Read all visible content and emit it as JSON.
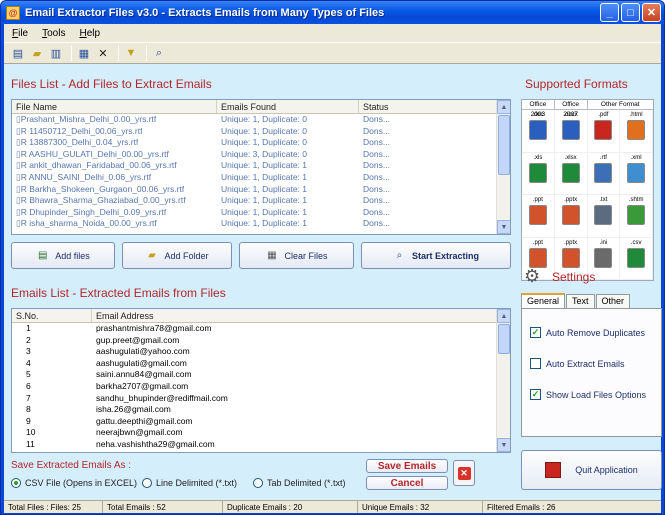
{
  "window": {
    "title": "Email Extractor Files v3.0 - Extracts Emails from Many Types of Files"
  },
  "menu": [
    {
      "key": "F",
      "rest": "ile"
    },
    {
      "key": "T",
      "rest": "ools"
    },
    {
      "key": "H",
      "rest": "elp"
    }
  ],
  "files_section": {
    "title": "Files List - Add Files to Extract Emails",
    "headers": [
      "File Name",
      "Emails Found",
      "Status"
    ],
    "rows": [
      [
        "Prashant_Mishra_Delhi_0.00_yrs.rtf",
        "Unique: 1, Duplicate: 0",
        "Dons..."
      ],
      [
        "R 11450712_Delhi_00.06_yrs.rtf",
        "Unique: 1, Duplicate: 0",
        "Dons..."
      ],
      [
        "R 13887300_Delhi_0.04_yrs.rtf",
        "Unique: 1, Duplicate: 0",
        "Dons..."
      ],
      [
        "R AASHU_GULATI_Delhi_00.00_yrs.rtf",
        "Unique: 3, Duplicate: 0",
        "Dons..."
      ],
      [
        "R ankit_dhawan_Faridabad_00.06_yrs.rtf",
        "Unique: 1, Duplicate: 1",
        "Dons..."
      ],
      [
        "R ANNU_SAINI_Delhi_0.06_yrs.rtf",
        "Unique: 1, Duplicate: 1",
        "Dons..."
      ],
      [
        "R Barkha_Shokeen_Gurgaon_00.06_yrs.rtf",
        "Unique: 1, Duplicate: 1",
        "Dons..."
      ],
      [
        "R Bhawra_Sharma_Ghaziabad_0.00_yrs.rtf",
        "Unique: 1, Duplicate: 1",
        "Dons..."
      ],
      [
        "R Dhupinder_Singh_Delhi_0.09_yrs.rtf",
        "Unique: 1, Duplicate: 1",
        "Dons..."
      ],
      [
        "R isha_sharma_Noida_00.00_yrs.rtf",
        "Unique: 1, Duplicate: 1",
        "Dons..."
      ]
    ]
  },
  "buttons": {
    "add_files": "Add files",
    "add_folder": "Add Folder",
    "clear_files": "Clear Files",
    "start_extracting": "Start Extracting",
    "save_emails": "Save Emails",
    "cancel": "Cancel",
    "quit": "Quit Application"
  },
  "emails_section": {
    "title": "Emails List - Extracted Emails from Files",
    "headers": [
      "S.No.",
      "Email Address"
    ],
    "rows": [
      [
        "1",
        "prashantmishra78@gmail.com"
      ],
      [
        "2",
        "gup.preet@gmail.com"
      ],
      [
        "3",
        "aashugulati@yahoo.com"
      ],
      [
        "4",
        "aashugulati@gmail.com"
      ],
      [
        "5",
        "saini.annu84@gmail.com"
      ],
      [
        "6",
        "barkha2707@gmail.com"
      ],
      [
        "7",
        "sandhu_bhupinder@rediffmail.com"
      ],
      [
        "8",
        "isha.26@gmail.com"
      ],
      [
        "9",
        "gattu.deepthi@gmail.com"
      ],
      [
        "10",
        "neerajbwn@gmail.com"
      ],
      [
        "11",
        "neha.vashishtha29@gmail.com"
      ]
    ]
  },
  "supported_formats": {
    "title": "Supported Formats",
    "columns": [
      "Office 2003",
      "Office 2007",
      "Other Format"
    ],
    "items": [
      {
        "ext": ".doc",
        "color": "#2b5fbf"
      },
      {
        "ext": ".docx",
        "color": "#2b5fbf"
      },
      {
        "ext": ".pdf",
        "color": "#c8261f"
      },
      {
        "ext": ".html",
        "color": "#e0701e"
      },
      {
        "ext": ".xls",
        "color": "#1f8a3a"
      },
      {
        "ext": ".xlsx",
        "color": "#1f8a3a"
      },
      {
        "ext": ".rtf",
        "color": "#3d6fb6"
      },
      {
        "ext": ".xml",
        "color": "#3f8fd0"
      },
      {
        "ext": ".ppt",
        "color": "#d2522b"
      },
      {
        "ext": ".pptx",
        "color": "#d2522b"
      },
      {
        "ext": ".txt",
        "color": "#5b6b80"
      },
      {
        "ext": ".shtm",
        "color": "#3a9a3a"
      },
      {
        "ext": ".ppt",
        "color": "#d2522b"
      },
      {
        "ext": ".pptx",
        "color": "#d2522b"
      },
      {
        "ext": ".ini",
        "color": "#6a6a6a"
      },
      {
        "ext": ".csv",
        "color": "#1f8a3a"
      }
    ]
  },
  "settings": {
    "title": "Settings",
    "tabs": [
      "General",
      "Text",
      "Other"
    ],
    "options": [
      {
        "label": "Auto Remove Duplicates",
        "checked": "✓"
      },
      {
        "label": "Auto Extract Emails",
        "checked": ""
      },
      {
        "label": "Show Load Files Options",
        "checked": "✓"
      }
    ]
  },
  "save_as": {
    "label": "Save Extracted Emails As :",
    "options": [
      "CSV File (Opens in EXCEL)",
      "Line Delimited (*.txt)",
      "Tab Delimited (*.txt)"
    ]
  },
  "status": {
    "total_files": "Total Files : Files: 25",
    "total_emails": "Total Emails :  52",
    "duplicate": "Duplicate Emails :  20",
    "unique": "Unique Emails :  32",
    "filtered": "Filtered Emails :  26"
  }
}
